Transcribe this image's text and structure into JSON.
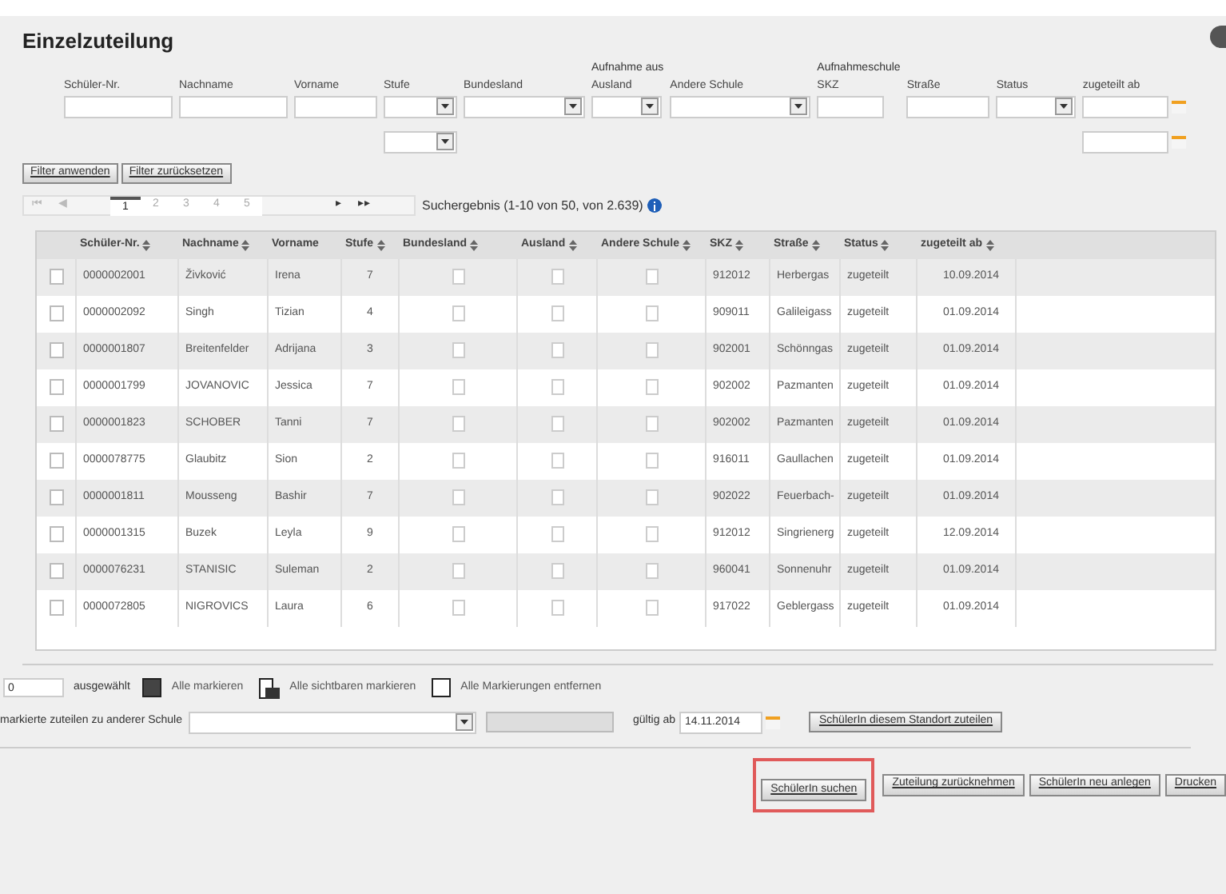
{
  "title": "Einzelzuteilung",
  "filters": [
    {
      "kind": "text",
      "label": "Schüler-Nr."
    },
    {
      "kind": "text",
      "label": "Nachname"
    },
    {
      "kind": "text",
      "label": "Vorname"
    },
    {
      "kind": "select",
      "label": "Stufe",
      "extra": true
    },
    {
      "kind": "select",
      "label": "Bundesland"
    },
    {
      "kind": "select",
      "label": "Ausland",
      "group": "Aufnahme aus"
    },
    {
      "kind": "select",
      "label": "Andere Schule"
    },
    {
      "kind": "text",
      "label": "SKZ",
      "group": "Aufnahmeschule"
    },
    {
      "kind": "text",
      "label": "Straße"
    },
    {
      "kind": "select",
      "label": "Status"
    },
    {
      "kind": "date",
      "label": "zugeteilt ab",
      "extra": true
    }
  ],
  "filter_buttons": [
    "Filter anwenden",
    "Filter zurücksetzen"
  ],
  "pager": {
    "first": "⏮",
    "previous": "◀",
    "pages": [
      {
        "label": "1",
        "selected": true
      },
      {
        "label": "2",
        "selected": false
      },
      {
        "label": "3",
        "selected": false
      },
      {
        "label": "4",
        "selected": false
      },
      {
        "label": "5",
        "selected": false
      }
    ],
    "next": "▸",
    "last": "▸▸",
    "result": "Suchergebnis (1-10 von 50, von 2.639)"
  },
  "table": {
    "columns": [
      {
        "label": "Schüler-Nr.",
        "sortable": true
      },
      {
        "label": "Nachname",
        "sortable": true
      },
      {
        "label": "Vorname",
        "sortable": false
      },
      {
        "label": "Stufe",
        "sortable": true
      },
      {
        "label": "Bundesland",
        "sortable": true
      },
      {
        "label": "Ausland",
        "sortable": true
      },
      {
        "label": "Andere Schule",
        "sortable": true
      },
      {
        "label": "SKZ",
        "sortable": true
      },
      {
        "label": "Straße",
        "sortable": true
      },
      {
        "label": "Status",
        "sortable": true
      },
      {
        "label": "zugeteilt ab",
        "sortable": true
      }
    ],
    "rows": [
      {
        "checked": false,
        "bundesland": false,
        "ausland": false,
        "andere_schule": false,
        "cells": [
          "0000002001",
          "Živković",
          "Irena",
          "7",
          "",
          "",
          "",
          "912012",
          "Herbergas",
          "zugeteilt",
          "10.09.2014"
        ]
      },
      {
        "checked": false,
        "bundesland": false,
        "ausland": false,
        "andere_schule": false,
        "cells": [
          "0000002092",
          "Singh",
          "Tizian",
          "4",
          "",
          "",
          "",
          "909011",
          "Galileigass",
          "zugeteilt",
          "01.09.2014"
        ]
      },
      {
        "checked": false,
        "bundesland": false,
        "ausland": false,
        "andere_schule": false,
        "cells": [
          "0000001807",
          "Breitenfelder",
          "Adrijana",
          "3",
          "",
          "",
          "",
          "902001",
          "Schönngas",
          "zugeteilt",
          "01.09.2014"
        ]
      },
      {
        "checked": false,
        "bundesland": false,
        "ausland": false,
        "andere_schule": false,
        "cells": [
          "0000001799",
          "JOVANOVIC",
          "Jessica",
          "7",
          "",
          "",
          "",
          "902002",
          "Pazmanten",
          "zugeteilt",
          "01.09.2014"
        ]
      },
      {
        "checked": false,
        "bundesland": false,
        "ausland": false,
        "andere_schule": false,
        "cells": [
          "0000001823",
          "SCHOBER",
          "Tanni",
          "7",
          "",
          "",
          "",
          "902002",
          "Pazmanten",
          "zugeteilt",
          "01.09.2014"
        ]
      },
      {
        "checked": false,
        "bundesland": false,
        "ausland": false,
        "andere_schule": false,
        "cells": [
          "0000078775",
          "Glaubitz",
          "Sion",
          "2",
          "",
          "",
          "",
          "916011",
          "Gaullachen",
          "zugeteilt",
          "01.09.2014"
        ]
      },
      {
        "checked": false,
        "bundesland": false,
        "ausland": false,
        "andere_schule": false,
        "cells": [
          "0000001811",
          "Mousseng",
          "Bashir",
          "7",
          "",
          "",
          "",
          "902022",
          "Feuerbach-",
          "zugeteilt",
          "01.09.2014"
        ]
      },
      {
        "checked": false,
        "bundesland": false,
        "ausland": false,
        "andere_schule": false,
        "cells": [
          "0000001315",
          "Buzek",
          "Leyla",
          "9",
          "",
          "",
          "",
          "912012",
          "Singrienerg",
          "zugeteilt",
          "12.09.2014"
        ]
      },
      {
        "checked": false,
        "bundesland": false,
        "ausland": false,
        "andere_schule": false,
        "cells": [
          "0000076231",
          "STANISIC",
          "Suleman",
          "2",
          "",
          "",
          "",
          "960041",
          "Sonnenuhr",
          "zugeteilt",
          "01.09.2014"
        ]
      },
      {
        "checked": false,
        "bundesland": false,
        "ausland": false,
        "andere_schule": false,
        "cells": [
          "0000072805",
          "NIGROVICS",
          "Laura",
          "6",
          "",
          "",
          "",
          "917022",
          "Geblergass",
          "zugeteilt",
          "01.09.2014"
        ]
      }
    ]
  },
  "selection": {
    "count": "0",
    "label": "ausgewählt",
    "actions": [
      {
        "kind": "all",
        "label": "Alle markieren"
      },
      {
        "kind": "visible",
        "label": "Alle sichtbaren markieren"
      },
      {
        "kind": "none",
        "label": "Alle Markierungen entfernen"
      }
    ]
  },
  "assign": {
    "label": "markierte zuteilen zu anderer Schule",
    "valid_label": "gültig ab",
    "valid_date": "14.11.2014",
    "button": "SchülerIn diesem Standort zuteilen"
  },
  "actions": [
    {
      "label": "SchülerIn suchen",
      "highlighted": true
    },
    {
      "label": "Zuteilung zurücknehmen",
      "highlighted": false
    },
    {
      "label": "SchülerIn neu anlegen",
      "highlighted": false
    },
    {
      "label": "Drucken",
      "highlighted": false
    }
  ]
}
